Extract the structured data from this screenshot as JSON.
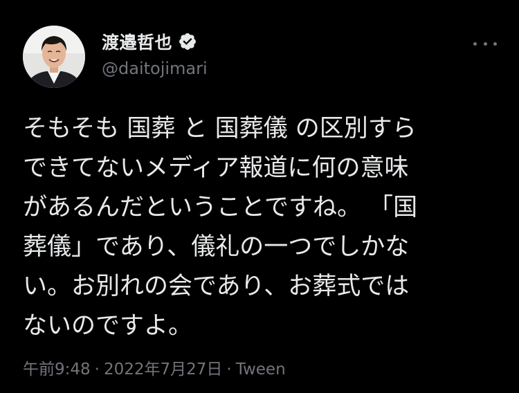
{
  "author": {
    "display_name": "渡邉哲也",
    "handle": "@daitojimari",
    "verified": true
  },
  "icons": {
    "verified": "verified-badge-icon",
    "more": "more-horizontal-icon"
  },
  "tweet": {
    "text": "そもそも 国葬 と 国葬儀 の区別すら\nできてないメディア報道に何の意味\nがあるんだということですね。 「国\n葬儀」であり、儀礼の一つでしかな\nい。お別れの会であり、お葬式では\nないのですよ。",
    "time": "午前9:48",
    "separator": "·",
    "date": "2022年7月27日",
    "source": "Tween"
  },
  "colors": {
    "background": "#000000",
    "text_primary": "#e7e9ea",
    "text_secondary": "#71767b",
    "verified_badge": "#e7e9ea"
  }
}
